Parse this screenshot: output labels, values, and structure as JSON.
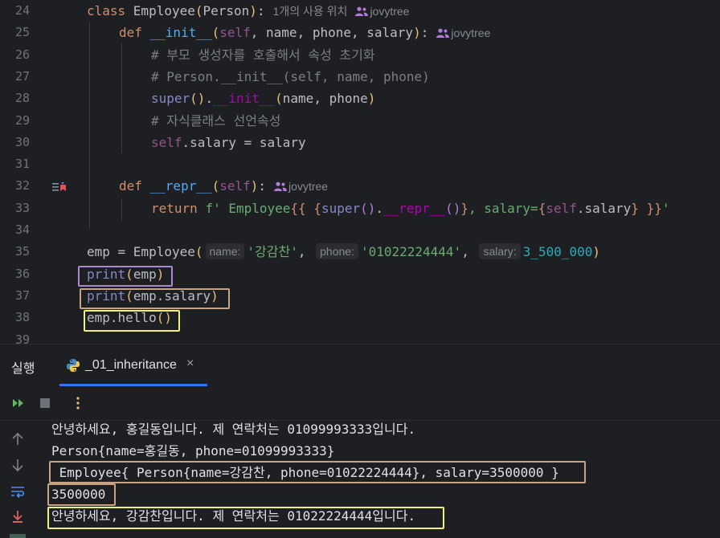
{
  "editor": {
    "lines": [
      {
        "num": "24",
        "parts": [
          [
            "kw",
            "class "
          ],
          [
            "",
            "Employee"
          ],
          [
            "par1",
            "("
          ],
          [
            "",
            "Person"
          ],
          [
            "par1",
            ")"
          ],
          [
            "",
            ":"
          ]
        ],
        "usage": "1개의 사용 위치",
        "author": "jovytree",
        "indent": 0
      },
      {
        "num": "25",
        "parts": [
          [
            "kw",
            "def "
          ],
          [
            "fn",
            "__init__"
          ],
          [
            "par1",
            "("
          ],
          [
            "self",
            "self"
          ],
          [
            "",
            ", name, phone, salary"
          ],
          [
            "par1",
            ")"
          ],
          [
            "",
            ":"
          ]
        ],
        "author": "jovytree",
        "indent": 1
      },
      {
        "num": "26",
        "parts": [
          [
            "cmt",
            "# 부모 생성자를 호출해서 속성 초기화"
          ]
        ],
        "indent": 2
      },
      {
        "num": "27",
        "parts": [
          [
            "cmt",
            "# Person.__init__(self, name, phone)"
          ]
        ],
        "indent": 2
      },
      {
        "num": "28",
        "parts": [
          [
            "builtin",
            "super"
          ],
          [
            "par1",
            "()"
          ],
          [
            "",
            ". "
          ],
          [
            "dunder",
            "__init__"
          ],
          [
            "par1",
            "("
          ],
          [
            "",
            "name, phone"
          ],
          [
            "par1",
            ")"
          ]
        ],
        "indent": 2
      },
      {
        "num": "29",
        "parts": [
          [
            "cmt",
            "# 자식클래스 선언속성"
          ]
        ],
        "indent": 2
      },
      {
        "num": "30",
        "parts": [
          [
            "self",
            "self"
          ],
          [
            "",
            ".salary = salary"
          ]
        ],
        "indent": 2
      },
      {
        "num": "31",
        "parts": [],
        "indent": 0
      },
      {
        "num": "32",
        "parts": [
          [
            "kw",
            "def "
          ],
          [
            "fn",
            "__repr__"
          ],
          [
            "par1",
            "("
          ],
          [
            "self",
            "self"
          ],
          [
            "par1",
            ")"
          ],
          [
            "",
            ":"
          ]
        ],
        "author": "jovytree",
        "indent": 1
      },
      {
        "num": "33",
        "parts": [
          [
            "kw",
            "return "
          ],
          [
            "str",
            "f' Employee"
          ],
          [
            "kw",
            "{{ {"
          ],
          [
            "builtin",
            "super"
          ],
          [
            "par2",
            "()"
          ],
          [
            "",
            ". "
          ],
          [
            "dunder",
            "__repr__"
          ],
          [
            "par2",
            "()"
          ],
          [
            "kw",
            "}"
          ],
          [
            "str",
            ", salary="
          ],
          [
            "kw",
            "{"
          ],
          [
            "self",
            "self"
          ],
          [
            "",
            ".salary"
          ],
          [
            "kw",
            "} }}"
          ],
          [
            "str",
            "'"
          ]
        ],
        "indent": 2
      },
      {
        "num": "34",
        "parts": [],
        "indent": 0
      },
      {
        "num": "35",
        "indent": 0
      },
      {
        "num": "36",
        "parts": [
          [
            "builtin",
            "print"
          ],
          [
            "par1",
            "("
          ],
          [
            "",
            "emp"
          ],
          [
            "par1",
            ")"
          ]
        ],
        "indent": 0
      },
      {
        "num": "37",
        "parts": [
          [
            "builtin",
            "print"
          ],
          [
            "par1",
            "("
          ],
          [
            "",
            "emp.salary"
          ],
          [
            "par1",
            ")"
          ]
        ],
        "indent": 0
      },
      {
        "num": "38",
        "parts": [
          [
            "",
            "emp.hello"
          ],
          [
            "par1",
            "()"
          ]
        ],
        "indent": 0
      },
      {
        "num": "39",
        "parts": [],
        "indent": 0
      }
    ],
    "line35": {
      "prefix": "emp = Employee(",
      "hint_name": "name:",
      "arg_name": "'강감찬'",
      "hint_phone": "phone:",
      "arg_phone": "'01022224444'",
      "hint_salary": "salary:",
      "arg_salary": "3_500_000",
      "suffix": ")"
    }
  },
  "run_panel": {
    "title": "실행",
    "tab_label": "_01_inheritance",
    "tab_close": "×"
  },
  "console": {
    "output": [
      "안녕하세요, 홍길동입니다. 제 연락처는 01099993333입니다.",
      "Person{name=홍길동, phone=01099993333}",
      " Employee{ Person{name=강감찬, phone=01022224444}, salary=3500000 }",
      "3500000",
      "안녕하세요, 강감찬입니다. 제 연락처는 01022224444입니다."
    ]
  },
  "colors": {
    "highlight_purple": "#a98ad0",
    "highlight_tan": "#c7a283",
    "highlight_yellow": "#f0f07a",
    "tab_underline": "#3574f0"
  }
}
